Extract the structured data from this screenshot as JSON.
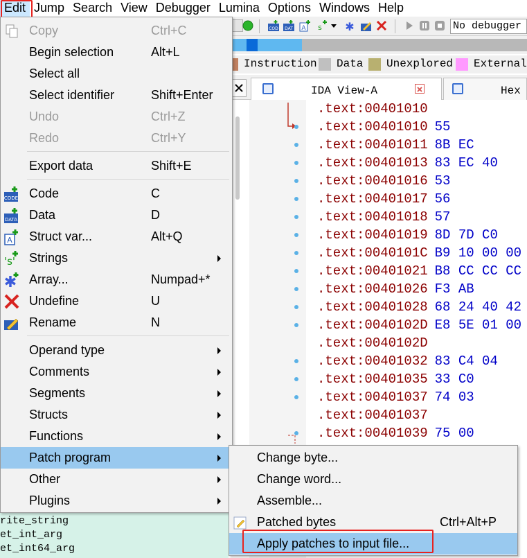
{
  "menubar": {
    "items": [
      "Edit",
      "Jump",
      "Search",
      "View",
      "Debugger",
      "Lumina",
      "Options",
      "Windows",
      "Help"
    ],
    "active": "Edit"
  },
  "toolbar": {
    "debugger": "No debugger"
  },
  "legend": [
    {
      "label": "Instruction",
      "color": "#c08060"
    },
    {
      "label": "Data",
      "color": "#c0c0c0"
    },
    {
      "label": "Unexplored",
      "color": "#b8b070"
    },
    {
      "label": "External",
      "color": "#ff99ff"
    }
  ],
  "tabs": {
    "ida_view": "IDA View-A",
    "hex_view": "Hex V"
  },
  "disasm": [
    {
      "addr": ".text:00401010",
      "bytes": ""
    },
    {
      "addr": ".text:00401010",
      "bytes": "55"
    },
    {
      "addr": ".text:00401011",
      "bytes": "8B EC"
    },
    {
      "addr": ".text:00401013",
      "bytes": "83 EC 40"
    },
    {
      "addr": ".text:00401016",
      "bytes": "53"
    },
    {
      "addr": ".text:00401017",
      "bytes": "56"
    },
    {
      "addr": ".text:00401018",
      "bytes": "57"
    },
    {
      "addr": ".text:00401019",
      "bytes": "8D 7D C0"
    },
    {
      "addr": ".text:0040101C",
      "bytes": "B9 10 00 00"
    },
    {
      "addr": ".text:00401021",
      "bytes": "B8 CC CC CC"
    },
    {
      "addr": ".text:00401026",
      "bytes": "F3 AB"
    },
    {
      "addr": ".text:00401028",
      "bytes": "68 24 40 42"
    },
    {
      "addr": ".text:0040102D",
      "bytes": "E8 5E 01 00"
    },
    {
      "addr": ".text:0040102D",
      "bytes": ""
    },
    {
      "addr": ".text:00401032",
      "bytes": "83 C4 04"
    },
    {
      "addr": ".text:00401035",
      "bytes": "33 C0"
    },
    {
      "addr": ".text:00401037",
      "bytes": "74 03"
    },
    {
      "addr": ".text:00401037",
      "bytes": ""
    },
    {
      "addr": ".text:00401039",
      "bytes": "75 00"
    }
  ],
  "functions": [
    "rite_string",
    "et_int_arg",
    "et_int64_arg"
  ],
  "edit_menu": {
    "copy": {
      "label": "Copy",
      "shortcut": "Ctrl+C"
    },
    "begin_selection": {
      "label": "Begin selection",
      "shortcut": "Alt+L"
    },
    "select_all": {
      "label": "Select all",
      "shortcut": ""
    },
    "select_identifier": {
      "label": "Select identifier",
      "shortcut": "Shift+Enter"
    },
    "undo": {
      "label": "Undo",
      "shortcut": "Ctrl+Z"
    },
    "redo": {
      "label": "Redo",
      "shortcut": "Ctrl+Y"
    },
    "export_data": {
      "label": "Export data",
      "shortcut": "Shift+E"
    },
    "code": {
      "label": "Code",
      "shortcut": "C"
    },
    "data": {
      "label": "Data",
      "shortcut": "D"
    },
    "struct_var": {
      "label": "Struct var...",
      "shortcut": "Alt+Q"
    },
    "strings": {
      "label": "Strings",
      "shortcut": ""
    },
    "array": {
      "label": "Array...",
      "shortcut": "Numpad+*"
    },
    "undefine": {
      "label": "Undefine",
      "shortcut": "U"
    },
    "rename": {
      "label": "Rename",
      "shortcut": "N"
    },
    "operand_type": {
      "label": "Operand type",
      "shortcut": ""
    },
    "comments": {
      "label": "Comments",
      "shortcut": ""
    },
    "segments": {
      "label": "Segments",
      "shortcut": ""
    },
    "structs": {
      "label": "Structs",
      "shortcut": ""
    },
    "functions": {
      "label": "Functions",
      "shortcut": ""
    },
    "patch_program": {
      "label": "Patch program",
      "shortcut": ""
    },
    "other": {
      "label": "Other",
      "shortcut": ""
    },
    "plugins": {
      "label": "Plugins",
      "shortcut": ""
    }
  },
  "patch_menu": {
    "change_byte": {
      "label": "Change byte...",
      "shortcut": ""
    },
    "change_word": {
      "label": "Change word...",
      "shortcut": ""
    },
    "assemble": {
      "label": "Assemble...",
      "shortcut": ""
    },
    "patched_bytes": {
      "label": "Patched bytes",
      "shortcut": "Ctrl+Alt+P"
    },
    "apply_patches": {
      "label": "Apply patches to input file...",
      "shortcut": ""
    }
  },
  "colors": {
    "highlight_box": "#e8231f",
    "menu_highlight": "#99c9ef",
    "address": "#8b0000",
    "bytes": "#0000c8"
  }
}
